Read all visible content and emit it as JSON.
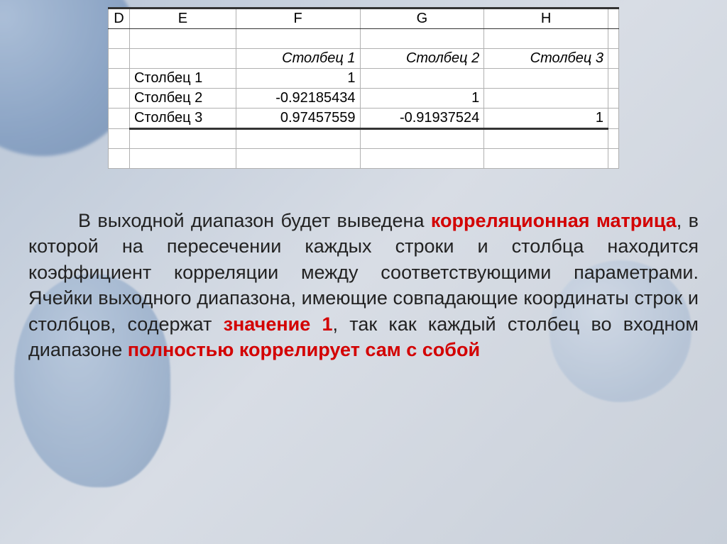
{
  "spreadsheet": {
    "columns": {
      "D": "D",
      "E": "E",
      "F": "F",
      "G": "G",
      "H": "H"
    },
    "header_row": {
      "F": "Столбец 1",
      "G": "Столбец 2",
      "H": "Столбец 3"
    },
    "rows": [
      {
        "label": "Столбец 1",
        "F": "1",
        "G": "",
        "H": ""
      },
      {
        "label": "Столбец 2",
        "F": "-0.92185434",
        "G": "1",
        "H": ""
      },
      {
        "label": "Столбец 3",
        "F": "0.97457559",
        "G": "-0.91937524",
        "H": "1"
      }
    ]
  },
  "text": {
    "p1a": "В выходной диапазон будет выведена ",
    "p1_red1": "корреляционная матрица",
    "p1b": ", в которой на пересечении каждых строки и столбца находится коэффициент корреляции между соответствующими параметрами. Ячейки выходного диапазона, имеющие совпадающие координаты строк и столбцов, содержат ",
    "p1_red2": "значение 1",
    "p1c": ", так как каждый столбец во входном диапазоне ",
    "p1_red3": "полностью коррелирует сам с собой"
  }
}
